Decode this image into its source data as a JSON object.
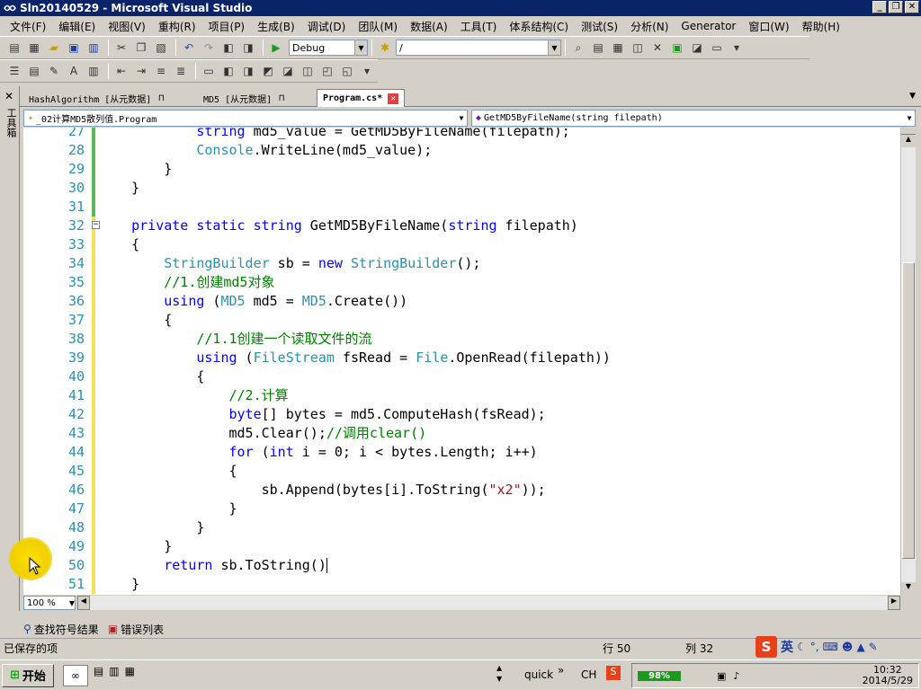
{
  "window": {
    "title": "Sln20140529 - Microsoft Visual Studio"
  },
  "menu": [
    "文件(F)",
    "编辑(E)",
    "视图(V)",
    "重构(R)",
    "项目(P)",
    "生成(B)",
    "调试(D)",
    "团队(M)",
    "数据(A)",
    "工具(T)",
    "体系结构(C)",
    "测试(S)",
    "分析(N)",
    "Generator",
    "窗口(W)",
    "帮助(H)"
  ],
  "toolbar": {
    "config": "Debug",
    "platform": "/"
  },
  "sidebar": {
    "label": "工具箱"
  },
  "tabs": [
    {
      "label": "HashAlgorithm [从元数据]",
      "active": false
    },
    {
      "label": "MD5 [从元数据]",
      "active": false
    },
    {
      "label": "Program.cs*",
      "active": true
    }
  ],
  "nav": {
    "type_combo": "_02计算MD5散列值.Program",
    "member_combo": "GetMD5ByFileName(string filepath)"
  },
  "code_lines": [
    {
      "n": "27",
      "t": "            string md5_value = GetMD5ByFileName(filepath);"
    },
    {
      "n": "28",
      "t": "            Console.WriteLine(md5_value);"
    },
    {
      "n": "29",
      "t": "        }"
    },
    {
      "n": "30",
      "t": "    }"
    },
    {
      "n": "31",
      "t": ""
    },
    {
      "n": "32",
      "t": "    private static string GetMD5ByFileName(string filepath)"
    },
    {
      "n": "33",
      "t": "    {"
    },
    {
      "n": "34",
      "t": "        StringBuilder sb = new StringBuilder();"
    },
    {
      "n": "35",
      "t": "        //1.创建md5对象"
    },
    {
      "n": "36",
      "t": "        using (MD5 md5 = MD5.Create())"
    },
    {
      "n": "37",
      "t": "        {"
    },
    {
      "n": "38",
      "t": "            //1.1创建一个读取文件的流"
    },
    {
      "n": "39",
      "t": "            using (FileStream fsRead = File.OpenRead(filepath))"
    },
    {
      "n": "40",
      "t": "            {"
    },
    {
      "n": "41",
      "t": "                //2.计算"
    },
    {
      "n": "42",
      "t": "                byte[] bytes = md5.ComputeHash(fsRead);"
    },
    {
      "n": "43",
      "t": "                md5.Clear();//调用clear()"
    },
    {
      "n": "44",
      "t": "                for (int i = 0; i < bytes.Length; i++)"
    },
    {
      "n": "45",
      "t": "                {"
    },
    {
      "n": "46",
      "t": "                    sb.Append(bytes[i].ToString(\"x2\"));"
    },
    {
      "n": "47",
      "t": "                }"
    },
    {
      "n": "48",
      "t": "            }"
    },
    {
      "n": "49",
      "t": "        }"
    },
    {
      "n": "50",
      "t": "        return sb.ToString()"
    },
    {
      "n": "51",
      "t": "    }"
    }
  ],
  "editor": {
    "zoom": "100 %"
  },
  "bottom_tabs": [
    "查找符号结果",
    "错误列表"
  ],
  "status": {
    "message": "已保存的项",
    "line": "行 50",
    "col": "列 32"
  },
  "ime": {
    "mode": "英"
  },
  "taskbar": {
    "start": "开始",
    "quick": "quick",
    "lang": "CH",
    "battery": "98%",
    "time": "10:32",
    "date": "2014/5/29"
  }
}
